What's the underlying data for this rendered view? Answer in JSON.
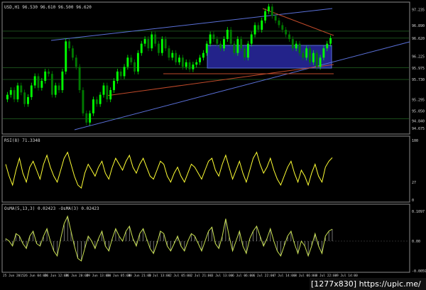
{
  "colors": {
    "background": "#000000",
    "frame": "#8a8a8a",
    "candle_up": "#00ff00",
    "candle_down": "#007a00",
    "text": "#d8d8d8",
    "box_fill": "#23238a",
    "blue_line": "#5a70d8",
    "red_line": "#c04a2a",
    "rsi_line": "#ffff33",
    "osma_line": "#c8e050",
    "osma_hist": "#e8e8e8",
    "level_line": "#2a7a2a"
  },
  "watermark": "[1277x830] https://upic.me/",
  "chart_data": [
    {
      "type": "line",
      "title": "USD,H1 96.530 96.610 96.500 96.620",
      "price_labels": [
        "97.235",
        "96.890",
        "96.620",
        "96.225",
        "95.975",
        "95.730",
        "95.295",
        "95.050",
        "94.840",
        "94.675"
      ],
      "ylim": [
        94.6,
        97.35
      ],
      "levels": [
        96.77,
        96.62,
        95.98,
        95.73,
        94.88
      ],
      "close": [
        95.4,
        95.5,
        95.3,
        95.6,
        95.45,
        95.2,
        95.35,
        95.6,
        95.8,
        95.55,
        95.7,
        95.9,
        95.85,
        95.4,
        95.6,
        95.5,
        95.9,
        96.55,
        96.4,
        96.2,
        96.0,
        95.5,
        95.0,
        94.8,
        95.0,
        95.3,
        95.2,
        95.4,
        95.6,
        95.3,
        95.5,
        95.7,
        95.9,
        95.8,
        96.0,
        96.2,
        96.1,
        95.9,
        96.3,
        96.5,
        96.6,
        96.4,
        96.7,
        96.5,
        96.3,
        96.6,
        96.4,
        96.2,
        96.3,
        96.1,
        96.2,
        96.0,
        96.1,
        95.95,
        96.05,
        96.1,
        96.2,
        96.3,
        96.5,
        96.7,
        96.6,
        96.5,
        96.4,
        96.6,
        96.8,
        96.5,
        96.3,
        96.6,
        96.4,
        96.2,
        96.5,
        96.7,
        96.9,
        96.8,
        97.0,
        97.2,
        97.3,
        97.1,
        97.0,
        96.9,
        96.8,
        96.7,
        96.6,
        96.4,
        96.5,
        96.3,
        96.2,
        96.4,
        96.1,
        96.3,
        96.0,
        96.2,
        96.4,
        96.5,
        96.62
      ],
      "x_labels": [
        "25 Jun 2015",
        "26 Jun 04:00",
        "26 Jun 12:00",
        "26 Jun 20:00",
        "29 Jun 13:00",
        "30 Jun 05:00",
        "30 Jun 21:00",
        "1 Jul 13:00",
        "2 Jul 05:00",
        "2 Jul 21:00",
        "3 Jul 13:00",
        "6 Jul 06:00",
        "6 Jul 22:00",
        "7 Jul 14:00",
        "8 Jul 06:00",
        "8 Jul 22:00",
        "9 Jul 14:00"
      ]
    },
    {
      "type": "line",
      "title": "RSI(8) 71.3348",
      "ylim": [
        0,
        100
      ],
      "tick_labels": [
        "100",
        "0"
      ],
      "mid_label": "27",
      "values": [
        60,
        40,
        25,
        50,
        70,
        45,
        30,
        55,
        65,
        50,
        35,
        60,
        75,
        55,
        40,
        30,
        50,
        70,
        80,
        60,
        40,
        25,
        20,
        45,
        60,
        50,
        40,
        55,
        65,
        45,
        35,
        55,
        70,
        60,
        50,
        65,
        75,
        55,
        45,
        60,
        70,
        55,
        40,
        35,
        50,
        65,
        60,
        40,
        30,
        45,
        55,
        40,
        30,
        45,
        60,
        55,
        45,
        35,
        50,
        65,
        70,
        50,
        40,
        60,
        75,
        55,
        35,
        50,
        65,
        45,
        30,
        50,
        70,
        80,
        60,
        45,
        55,
        70,
        50,
        35,
        25,
        40,
        55,
        65,
        45,
        30,
        50,
        40,
        25,
        45,
        60,
        40,
        30,
        55,
        65,
        71
      ]
    },
    {
      "type": "line",
      "title": "OsMA(5,13,3) 0.02423 -OsMA(3) 0.02423",
      "ylim": [
        -0.06,
        0.06
      ],
      "tick_labels": [
        "0.1097",
        "0.00",
        "-0.0059"
      ],
      "values": [
        0.005,
        0.0,
        -0.01,
        0.015,
        0.01,
        -0.005,
        -0.015,
        0.01,
        0.02,
        -0.005,
        -0.01,
        0.01,
        0.025,
        0.0,
        -0.02,
        -0.03,
        0.005,
        0.035,
        0.05,
        0.02,
        -0.01,
        -0.035,
        -0.04,
        -0.015,
        0.01,
        0.0,
        -0.015,
        0.005,
        0.02,
        -0.01,
        -0.02,
        0.005,
        0.025,
        0.01,
        0.0,
        0.02,
        0.03,
        0.005,
        -0.01,
        0.015,
        0.025,
        0.005,
        -0.015,
        -0.025,
        -0.005,
        0.02,
        0.015,
        -0.01,
        -0.02,
        -0.005,
        0.01,
        -0.01,
        -0.02,
        0.0,
        0.015,
        0.01,
        -0.005,
        -0.02,
        0.0,
        0.02,
        0.028,
        -0.005,
        -0.015,
        0.01,
        0.045,
        0.01,
        -0.02,
        0.0,
        0.02,
        -0.01,
        -0.025,
        0.005,
        0.02,
        0.03,
        0.01,
        -0.01,
        0.005,
        0.025,
        0.0,
        -0.02,
        -0.03,
        -0.01,
        0.01,
        0.02,
        -0.005,
        -0.025,
        0.0,
        -0.01,
        -0.03,
        -0.01,
        0.015,
        -0.01,
        -0.025,
        0.01,
        0.02,
        0.024
      ]
    }
  ]
}
